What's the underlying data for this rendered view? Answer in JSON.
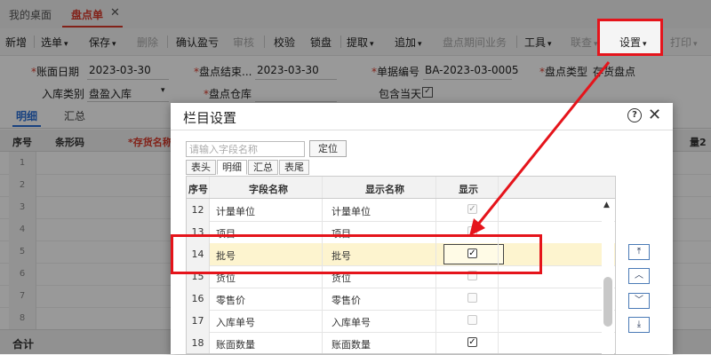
{
  "tabs": [
    "我的桌面",
    "盘点单"
  ],
  "tab_close": "✕",
  "toolbar": {
    "items": [
      {
        "label": "新增",
        "dropdown": false,
        "disabled": false
      },
      {
        "label": "选单",
        "dropdown": true,
        "disabled": false
      },
      {
        "label": "保存",
        "dropdown": true,
        "disabled": false
      },
      {
        "label": "删除",
        "dropdown": false,
        "disabled": true
      },
      {
        "label": "确认盈亏",
        "dropdown": false,
        "disabled": false
      },
      {
        "label": "审核",
        "dropdown": false,
        "disabled": true
      },
      {
        "label": "校验",
        "dropdown": false,
        "disabled": false
      },
      {
        "label": "锁盘",
        "dropdown": false,
        "disabled": false
      },
      {
        "label": "提取",
        "dropdown": true,
        "disabled": false
      },
      {
        "label": "追加",
        "dropdown": true,
        "disabled": false
      },
      {
        "label": "盘点期间业务",
        "dropdown": false,
        "disabled": true
      },
      {
        "label": "工具",
        "dropdown": true,
        "disabled": false
      },
      {
        "label": "联查",
        "dropdown": true,
        "disabled": true
      },
      {
        "label": "设置",
        "dropdown": true,
        "disabled": false
      },
      {
        "label": "打印",
        "dropdown": true,
        "disabled": true
      }
    ]
  },
  "form": {
    "book_date_label": "账面日期",
    "book_date": "2023-03-30",
    "end_date_label": "盘点结束...",
    "end_date": "2023-03-30",
    "doc_no_label": "单据编号",
    "doc_no": "BA-2023-03-0005",
    "type_label": "盘点类型",
    "type_value": "存货盘点",
    "inbound_label": "入库类别",
    "inbound_value": "盘盈入库",
    "warehouse_label": "盘点仓库",
    "include_today_label": "包含当天"
  },
  "subtabs": [
    "明细",
    "汇总"
  ],
  "grid": {
    "headers": [
      "序号",
      "条形码",
      "*存货名称",
      "量2"
    ],
    "row_numbers": [
      "1",
      "2",
      "3",
      "4",
      "5",
      "6",
      "7",
      "8"
    ],
    "total_label": "合计"
  },
  "dialog": {
    "title": "栏目设置",
    "help_icon": "?",
    "close_icon": "✕",
    "search_placeholder": "请输入字段名称",
    "locate_button": "定位",
    "tabs": [
      "表头",
      "明细",
      "汇总",
      "表尾"
    ],
    "table": {
      "headers": [
        "序号",
        "字段名称",
        "显示名称",
        "显示"
      ],
      "rows": [
        {
          "no": "12",
          "field": "计量单位",
          "display": "计量单位",
          "show": true
        },
        {
          "no": "13",
          "field": "项目",
          "display": "项目",
          "show": false
        },
        {
          "no": "14",
          "field": "批号",
          "display": "批号",
          "show": true
        },
        {
          "no": "15",
          "field": "货位",
          "display": "货位",
          "show": false
        },
        {
          "no": "16",
          "field": "零售价",
          "display": "零售价",
          "show": false
        },
        {
          "no": "17",
          "field": "入库单号",
          "display": "入库单号",
          "show": false
        },
        {
          "no": "18",
          "field": "账面数量",
          "display": "账面数量",
          "show": true
        }
      ]
    },
    "move_buttons": [
      "top",
      "up",
      "down",
      "bottom"
    ]
  },
  "colors": {
    "accent_red": "#d93a2b",
    "annotation_red": "#e5141b",
    "highlight": "#fdf4cf"
  }
}
